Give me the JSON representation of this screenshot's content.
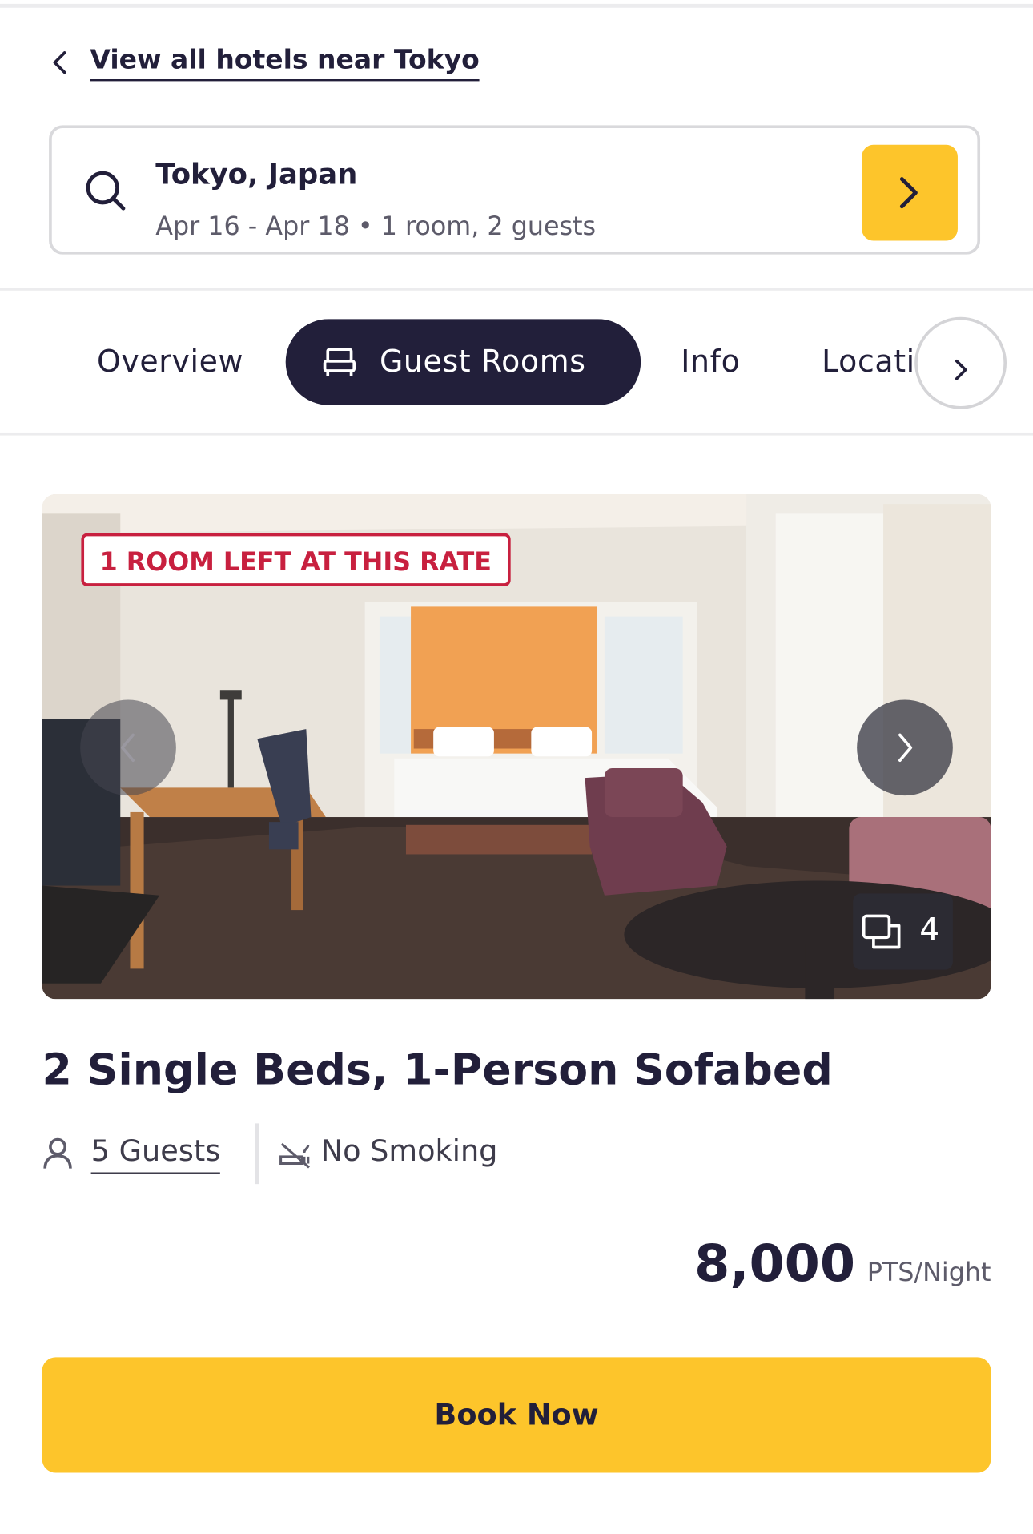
{
  "nav": {
    "back_label": "View all hotels near Tokyo"
  },
  "search": {
    "destination": "Tokyo, Japan",
    "details": "Apr 16 - Apr 18 • 1 room, 2 guests"
  },
  "tabs": [
    {
      "label": "Overview",
      "icon": "",
      "active": false
    },
    {
      "label": "Guest Rooms",
      "icon": "bed-icon",
      "active": true
    },
    {
      "label": "Info",
      "icon": "",
      "active": false
    },
    {
      "label": "Location",
      "icon": "",
      "active": false
    }
  ],
  "room": {
    "badge": "1 ROOM LEFT AT THIS RATE",
    "photo_count": "4",
    "title": "2 Single Beds, 1-Person Sofabed",
    "guests": "5 Guests",
    "smoking": "No Smoking",
    "price": "8,000",
    "price_unit": "PTS/Night"
  },
  "actions": {
    "book_label": "Book Now"
  },
  "colors": {
    "accent": "#fdc52b",
    "dark": "#221f3a",
    "badge": "#c8203f"
  }
}
